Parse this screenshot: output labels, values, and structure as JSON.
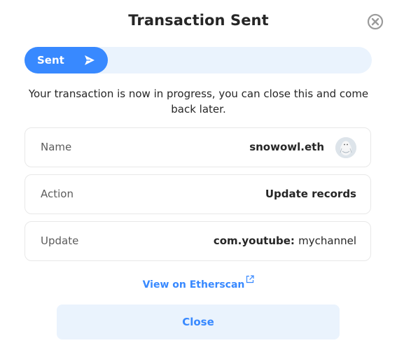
{
  "modal": {
    "title": "Transaction Sent",
    "close_icon": "close-circle-icon"
  },
  "progress": {
    "label": "Sent",
    "icon": "send-arrow-icon",
    "fill_fraction": 0.24
  },
  "message": "Your transaction is now in progress, you can close this and come back later.",
  "details": {
    "name": {
      "label": "Name",
      "value": "snowowl.eth",
      "avatar_icon": "owl-avatar"
    },
    "action": {
      "label": "Action",
      "value": "Update records"
    },
    "update": {
      "label": "Update",
      "key": "com.youtube:",
      "value": "mychannel"
    }
  },
  "etherscan_link": {
    "label": "View on Etherscan",
    "icon": "external-link-icon"
  },
  "close_button": {
    "label": "Close"
  },
  "colors": {
    "accent": "#3889ff",
    "accent_light": "#eaf3fd",
    "border": "#e8e8e8",
    "text": "#262626",
    "muted_text": "#5c5c5c"
  }
}
